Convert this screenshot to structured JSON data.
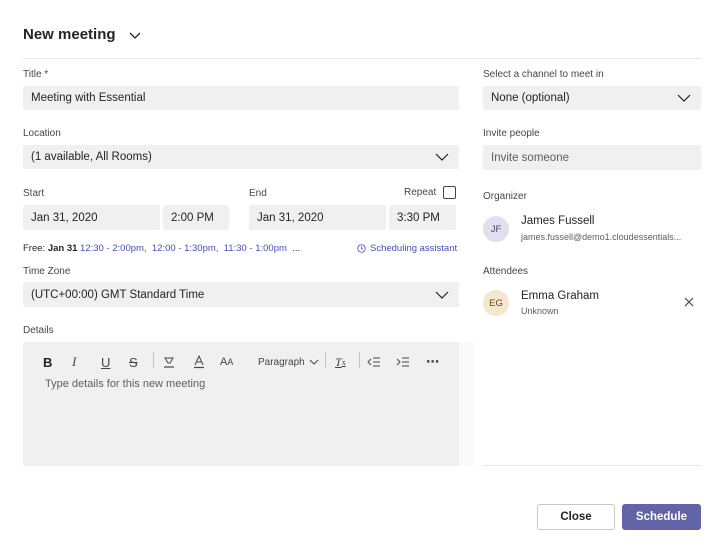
{
  "header": {
    "title": "New meeting"
  },
  "form": {
    "title_label": "Title *",
    "title_value": "Meeting with Essential",
    "location_label": "Location",
    "location_value": "(1 available, All Rooms)",
    "start_label": "Start",
    "start_date": "Jan 31, 2020",
    "start_time": "2:00 PM",
    "end_label": "End",
    "end_date": "Jan 31, 2020",
    "end_time": "3:30 PM",
    "repeat_label": "Repeat",
    "free_prefix": "Free:",
    "free_date": "Jan 31",
    "free_slots": [
      "12:30 - 2:00pm,",
      "12:00 - 1:30pm,",
      "11:30 - 1:00pm"
    ],
    "free_more": "...",
    "scheduling_assistant": "Scheduling assistant",
    "timezone_label": "Time Zone",
    "timezone_value": "(UTC+00:00) GMT Standard Time",
    "details_label": "Details",
    "details_placeholder": "Type details for this new meeting",
    "paragraph_label": "Paragraph"
  },
  "right": {
    "channel_label": "Select a channel to meet in",
    "channel_value": "None (optional)",
    "invite_label": "Invite people",
    "invite_placeholder": "Invite someone",
    "organizer_label": "Organizer",
    "organizer": {
      "initials": "JF",
      "name": "James Fussell",
      "email": "james.fussell@demo1.cloudessentials..."
    },
    "attendees_label": "Attendees",
    "attendee": {
      "initials": "EG",
      "name": "Emma Graham",
      "status": "Unknown"
    }
  },
  "footer": {
    "close_label": "Close",
    "schedule_label": "Schedule"
  },
  "colors": {
    "accent": "#6264a7",
    "link": "#464eb8",
    "field_bg": "#f0f0f0"
  }
}
